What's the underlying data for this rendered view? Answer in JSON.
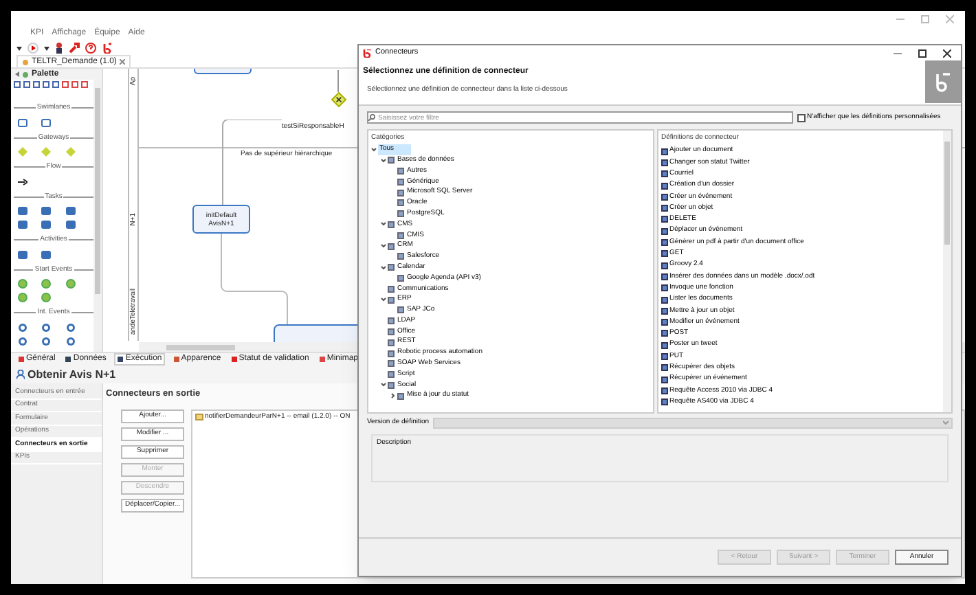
{
  "app": {
    "menu": [
      "KPI",
      "Affichage",
      "Équipe",
      "Aide"
    ],
    "editor_tab": "TELTR_Demande (1.0)",
    "palette": {
      "title": "Palette",
      "sections": [
        "Swimlanes",
        "Gateways",
        "Flow",
        "Tasks",
        "Activities",
        "Start Events",
        "Int. Events"
      ]
    },
    "diagram": {
      "lanes": [
        "Ap",
        "N+1",
        "andeTeletravail"
      ],
      "gateway_label": "testSiResponsableH",
      "flow_label": "Pas de supérieur hiérarchique",
      "task_lines": [
        "initDefault",
        "AvisN+1"
      ]
    },
    "property_tabs": [
      {
        "label": "Général",
        "selected": false
      },
      {
        "label": "Données",
        "selected": false
      },
      {
        "label": "Exécution",
        "selected": true
      },
      {
        "label": "Apparence",
        "selected": false
      },
      {
        "label": "Statut de validation",
        "selected": false
      },
      {
        "label": "Minimap",
        "selected": false
      }
    ],
    "element_title": "Obtenir Avis N+1",
    "nav": [
      {
        "label": "Connecteurs en entrée",
        "selected": false
      },
      {
        "label": "Contrat",
        "selected": false
      },
      {
        "label": "Formulaire",
        "selected": false
      },
      {
        "label": "Opérations",
        "selected": false
      },
      {
        "label": "Connecteurs en sortie",
        "selected": true
      },
      {
        "label": "KPIs",
        "selected": false
      }
    ],
    "section_title": "Connecteurs en sortie",
    "buttons": [
      {
        "label": "Ajouter...",
        "disabled": false
      },
      {
        "label": "Modifier ...",
        "disabled": false
      },
      {
        "label": "Supprimer",
        "disabled": false
      },
      {
        "label": "Monter",
        "disabled": true
      },
      {
        "label": "Descendre",
        "disabled": true
      },
      {
        "label": "Déplacer/Copier...",
        "disabled": false
      }
    ],
    "connectors": [
      "notifierDemandeurParN+1 -- email (1.2.0) -- ON"
    ]
  },
  "dialog": {
    "title": "Connecteurs",
    "heading": "Sélectionnez une définition de connecteur",
    "subtitle": "Sélectionnez une définition de connecteur dans la liste ci-dessous",
    "filter": {
      "placeholder": "Saisissez votre filtre"
    },
    "custom_only": {
      "label": "N'afficher que les définitions personnalisées",
      "checked": false
    },
    "categories_header": "Catégories",
    "categories": [
      {
        "label": "Tous",
        "selected": true,
        "expanded": true,
        "children": [
          {
            "label": "Bases de données",
            "selected": false,
            "expanded": true,
            "children": [
              {
                "label": "Autres",
                "selected": false
              },
              {
                "label": "Générique",
                "selected": false
              },
              {
                "label": "Microsoft SQL Server",
                "selected": false
              },
              {
                "label": "Oracle",
                "selected": false
              },
              {
                "label": "PostgreSQL",
                "selected": false
              }
            ]
          },
          {
            "label": "CMS",
            "selected": false,
            "expanded": true,
            "children": [
              {
                "label": "CMIS",
                "selected": false
              }
            ]
          },
          {
            "label": "CRM",
            "selected": false,
            "expanded": true,
            "children": [
              {
                "label": "Salesforce",
                "selected": false
              }
            ]
          },
          {
            "label": "Calendar",
            "selected": false,
            "expanded": true,
            "children": [
              {
                "label": "Google Agenda (API v3)",
                "selected": false
              }
            ]
          },
          {
            "label": "Communications",
            "selected": false
          },
          {
            "label": "ERP",
            "selected": false,
            "expanded": true,
            "children": [
              {
                "label": "SAP JCo",
                "selected": false
              }
            ]
          },
          {
            "label": "LDAP",
            "selected": false
          },
          {
            "label": "Office",
            "selected": false
          },
          {
            "label": "REST",
            "selected": false
          },
          {
            "label": "Robotic process automation",
            "selected": false
          },
          {
            "label": "SOAP Web Services",
            "selected": false
          },
          {
            "label": "Script",
            "selected": false
          },
          {
            "label": "Social",
            "selected": false,
            "expanded": true,
            "children": [
              {
                "label": "Mise à jour du statut",
                "selected": false,
                "expanded": false
              }
            ]
          }
        ]
      }
    ],
    "definitions_header": "Définitions de connecteur",
    "definitions": [
      "Ajouter un document",
      "Changer son statut Twitter",
      "Courriel",
      "Création d'un dossier",
      "Créer un événement",
      "Créer un objet",
      "DELETE",
      "Déplacer un événement",
      "Générer un pdf à partir d'un document office",
      "GET",
      "Groovy 2.4",
      "Insérer des données dans un modèle .docx/.odt",
      "Invoque une fonction",
      "Lister les documents",
      "Mettre à jour un objet",
      "Modifier un événement",
      "POST",
      "Poster un tweet",
      "PUT",
      "Récupérer des objets",
      "Récupérer un événement",
      "Requête Access 2010 via JDBC 4",
      "Requête AS400 via JDBC 4"
    ],
    "version_label": "Version de définition",
    "description_label": "Description",
    "buttons": [
      {
        "label": "< Retour",
        "disabled": true
      },
      {
        "label": "Suivant >",
        "disabled": true
      },
      {
        "label": "Terminer",
        "disabled": true
      },
      {
        "label": "Annuler",
        "disabled": false
      }
    ]
  }
}
